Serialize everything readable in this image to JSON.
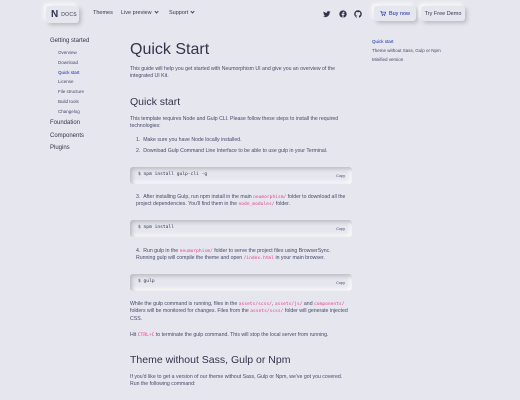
{
  "navbar": {
    "brand_letter": "N",
    "brand_label": "DOCS",
    "links": [
      "Themes",
      "Live preview",
      "Support"
    ],
    "social": [
      "twitter-icon",
      "facebook-icon",
      "github-icon"
    ],
    "buy_label": "Buy now",
    "free_label": "Try Free Demo"
  },
  "sidebar": {
    "section": "Getting started",
    "items": [
      "Overview",
      "Download",
      "Quick start",
      "License",
      "File structure",
      "Build tools",
      "Changelog"
    ],
    "active": "Quick start",
    "groups": [
      "Foundation",
      "Components",
      "Plugins"
    ]
  },
  "toc": {
    "items": [
      "Quick start",
      "Theme without Sass, Gulp or Npm",
      "Minified version"
    ],
    "active": "Quick start"
  },
  "main": {
    "title": "Quick Start",
    "intro": "This guide will help you get started with Neumorphism UI and give you an overview of the integrated UI Kit.",
    "h2_quickstart": "Quick start",
    "p_requires": "This template requires Node and Gulp CLI. Please follow these steps to install the required technologies:",
    "step1": "Make sure you have Node locally installed.",
    "step2": "Download Gulp Command Line Interface to be able to use gulp in your Terminal.",
    "code1": "$ npm install gulp-cli -g",
    "copy_label": "Copy",
    "step3_a": "After installing Gulp, run npm install in the main ",
    "step3_code1": "neumorphism/",
    "step3_b": " folder to download all the project dependencies. You'll find them in the ",
    "step3_code2": "node_modules/",
    "step3_c": " folder.",
    "code2": "$ npm install",
    "step4_a": "Run gulp in the ",
    "step4_code1": "neumorphism/",
    "step4_b": " folder to serve the project files using BrowserSync. Running gulp will compile the theme and open ",
    "step4_code2": "/index.html",
    "step4_c": " in your main browser.",
    "code3": "$ gulp",
    "watch_a": "While the gulp command is running, files in the ",
    "watch_code1": "assets/scss/",
    "watch_sep1": ", ",
    "watch_code2": "assets/js/",
    "watch_sep2": " and ",
    "watch_code3": "components/",
    "watch_b": " folders will be monitored for changes. Files from the ",
    "watch_code4": "assets/scss/",
    "watch_c": " folder will generate injected CSS.",
    "hit_a": "Hit ",
    "hit_code": "CTRL+C",
    "hit_b": " to terminate the gulp command. This will stop the local server from running.",
    "h2_theme": "Theme without Sass, Gulp or Npm",
    "p_theme": "If you'd like to get a version of our theme without Sass, Gulp or Npm, we've got you covered. Run the following command:"
  }
}
